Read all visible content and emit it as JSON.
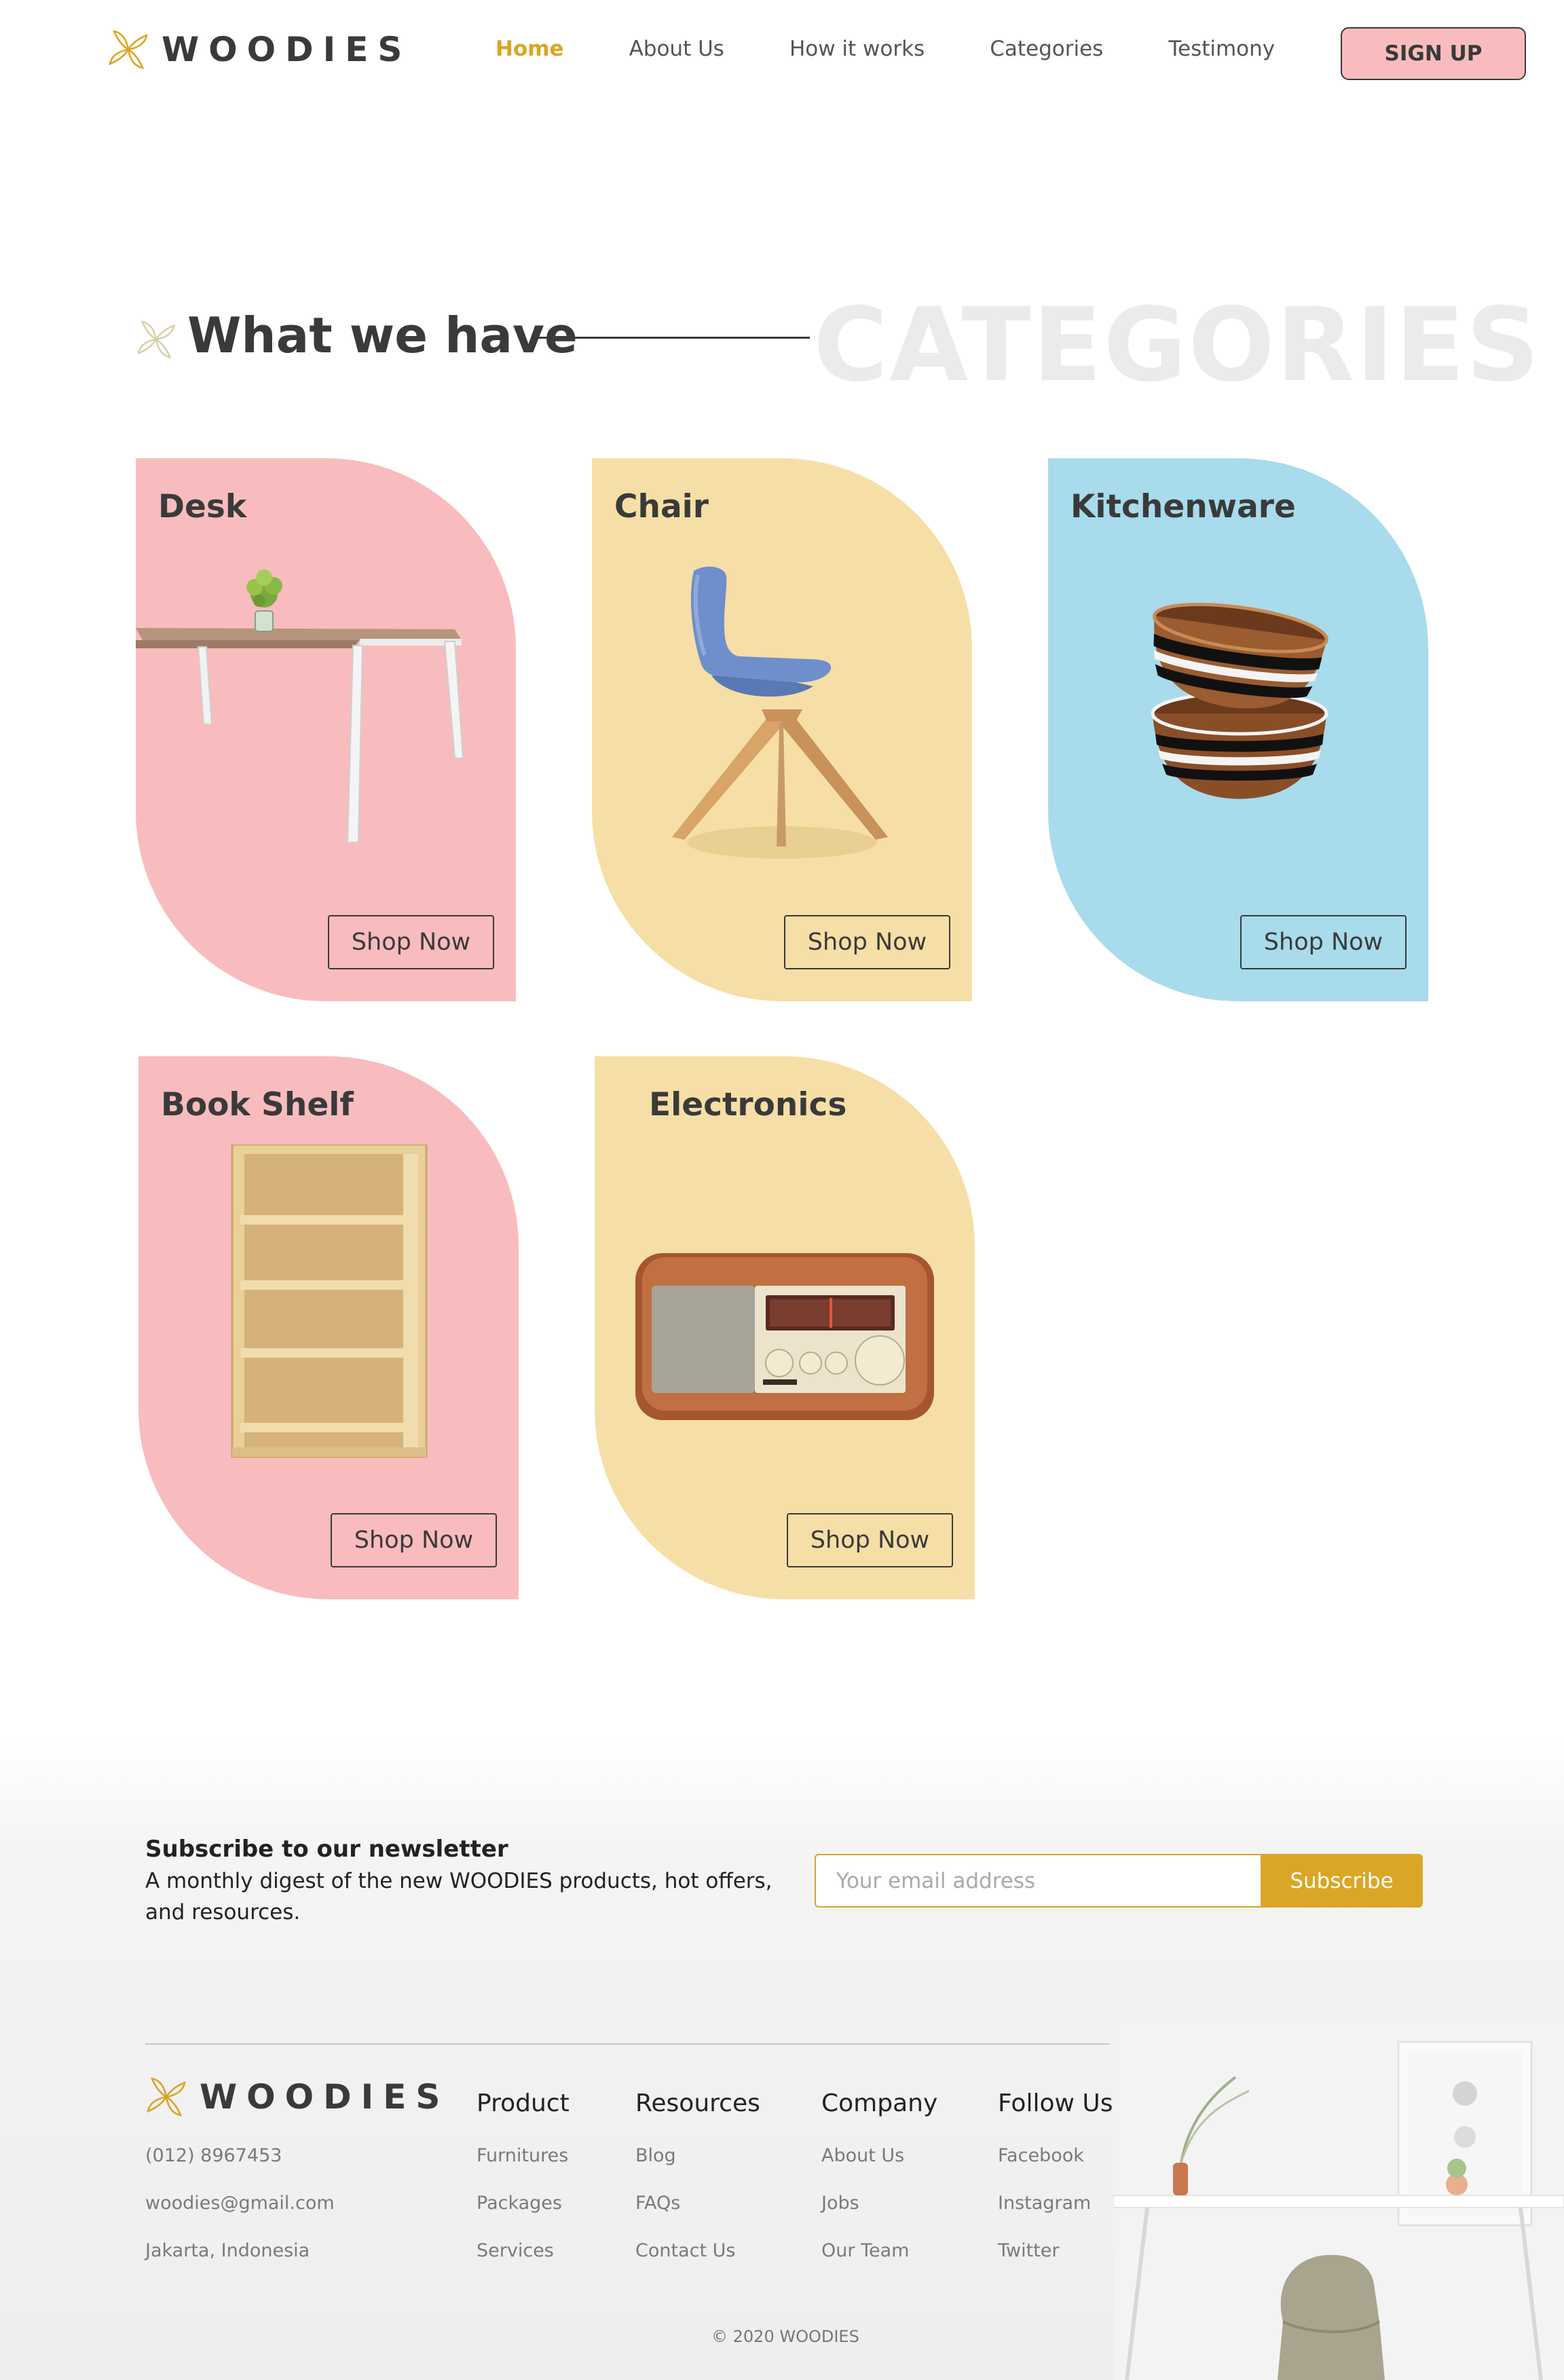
{
  "brand": {
    "name": "WOODIES",
    "accent": "#dba625"
  },
  "nav": {
    "links": [
      "Home",
      "About Us",
      "How it works",
      "Categories",
      "Testimony"
    ],
    "active": "Home",
    "signup": "SIGN UP"
  },
  "section": {
    "heading": "What we have",
    "ghost": "CATEGORIES"
  },
  "categories": [
    {
      "name": "Desk",
      "cta": "Shop Now",
      "color": "#f8bcbe"
    },
    {
      "name": "Chair",
      "cta": "Shop Now",
      "color": "#f6dfa6"
    },
    {
      "name": "Kitchenware",
      "cta": "Shop Now",
      "color": "#a8dbeb"
    },
    {
      "name": "Book Shelf",
      "cta": "Shop Now",
      "color": "#f8bcbe"
    },
    {
      "name": "Electronics",
      "cta": "Shop Now",
      "color": "#f6dfa6"
    }
  ],
  "newsletter": {
    "title": "Subscribe to our newsletter",
    "description": "A monthly digest of the new WOODIES products, hot offers, and resources.",
    "placeholder": "Your email address",
    "button": "Subscribe"
  },
  "footer": {
    "contact": [
      "(012) 8967453",
      "woodies@gmail.com",
      "Jakarta, Indonesia"
    ],
    "columns": [
      {
        "title": "Product",
        "items": [
          "Furnitures",
          "Packages",
          "Services"
        ]
      },
      {
        "title": "Resources",
        "items": [
          "Blog",
          "FAQs",
          "Contact Us"
        ]
      },
      {
        "title": "Company",
        "items": [
          "About Us",
          "Jobs",
          "Our Team"
        ]
      },
      {
        "title": "Follow Us",
        "items": [
          "Facebook",
          "Instagram",
          "Twitter"
        ]
      }
    ],
    "copyright": "© 2020 WOODIES"
  }
}
